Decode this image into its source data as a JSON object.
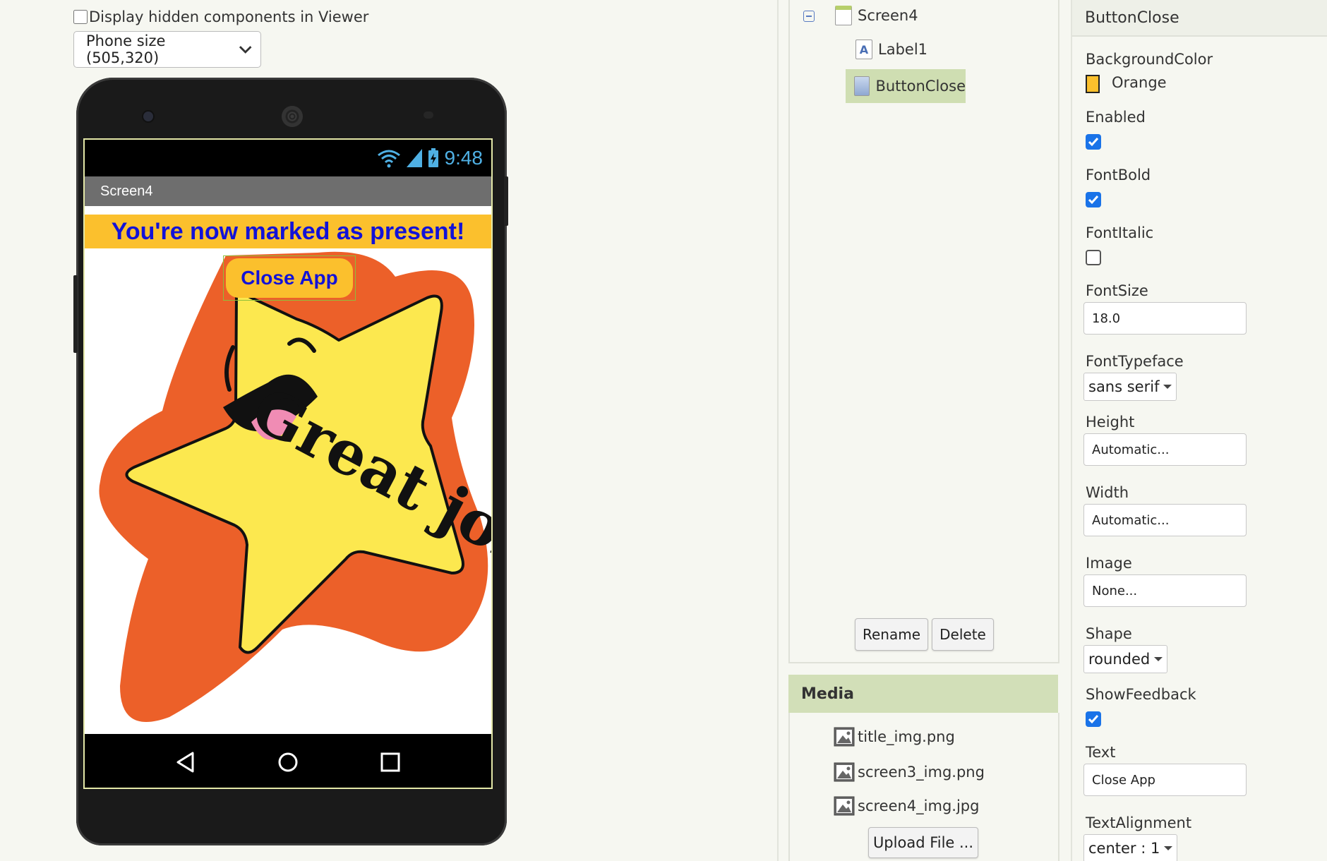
{
  "viewer": {
    "hidden_label": "Display hidden components in Viewer",
    "phone_size": "Phone size (505,320)"
  },
  "phone": {
    "time": "9:48",
    "screen_title": "Screen4",
    "label1_text": "You're now marked as present!",
    "button_text": "Close App",
    "image_text": "Great job!"
  },
  "components": {
    "tree": [
      "Screen4",
      "Label1",
      "ButtonClose"
    ],
    "rename_label": "Rename",
    "delete_label": "Delete"
  },
  "media": {
    "header": "Media",
    "files": [
      "title_img.png",
      "screen3_img.png",
      "screen4_img.jpg"
    ],
    "upload_label": "Upload File ..."
  },
  "properties": {
    "component": "ButtonClose",
    "background_color_label": "BackgroundColor",
    "background_color_value": "Orange",
    "background_color_hex": "#fbc02d",
    "enabled_label": "Enabled",
    "enabled": true,
    "fontbold_label": "FontBold",
    "fontbold": true,
    "fontitalic_label": "FontItalic",
    "fontitalic": false,
    "fontsize_label": "FontSize",
    "fontsize_value": "18.0",
    "typeface_label": "FontTypeface",
    "typeface_value": "sans serif",
    "height_label": "Height",
    "height_value": "Automatic...",
    "width_label": "Width",
    "width_value": "Automatic...",
    "image_label": "Image",
    "image_value": "None...",
    "shape_label": "Shape",
    "shape_value": "rounded",
    "feedback_label": "ShowFeedback",
    "feedback": true,
    "text_label": "Text",
    "text_value": "Close App",
    "align_label": "TextAlignment",
    "align_value": "center : 1"
  },
  "colors": {
    "label_bg": "#fbc02d",
    "label_text": "#1212d8",
    "selected_row": "#cfdeb2",
    "media_header": "#d2dfb8",
    "check_on": "#1a73e8"
  }
}
